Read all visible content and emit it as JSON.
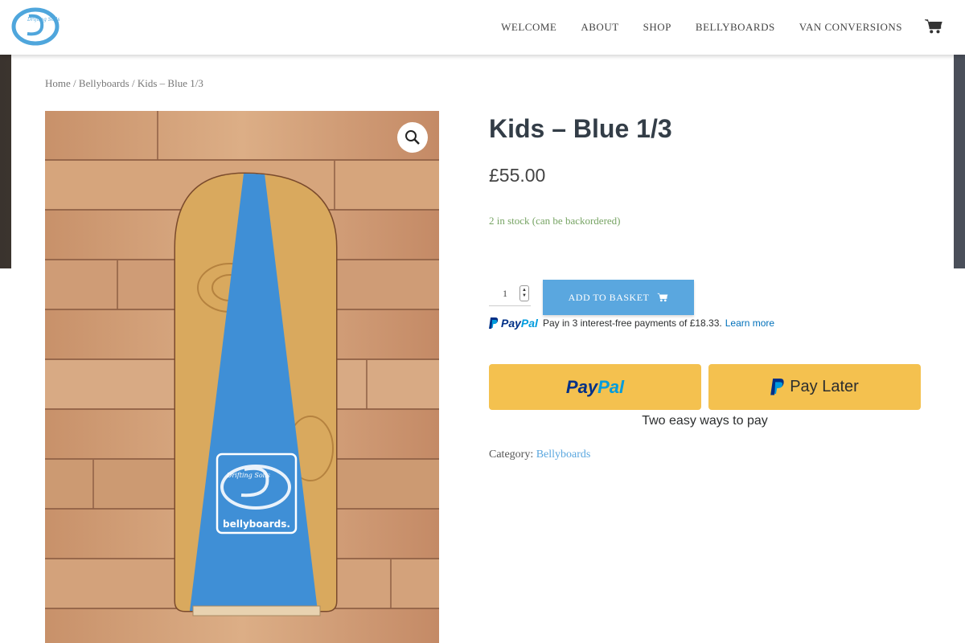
{
  "nav": {
    "items": [
      "WELCOME",
      "ABOUT",
      "SHOP",
      "BELLYBOARDS",
      "VAN CONVERSIONS"
    ],
    "cart_icon": "shopping-cart-icon"
  },
  "breadcrumb": {
    "home": "Home",
    "sep": " / ",
    "category": "Bellyboards",
    "current": "Kids – Blue 1/3"
  },
  "product": {
    "title": "Kids – Blue 1/3",
    "price": "£55.00",
    "stock": "2 in stock (can be backordered)",
    "quantity": "1",
    "add_to_basket": "ADD TO BASKET",
    "category_label": "Category:",
    "category_value": "Bellyboards",
    "image_logo_line1": "Drifting Soils",
    "image_logo_line2": "bellyboards."
  },
  "paypal": {
    "logo_pay": "Pay",
    "logo_pal": "Pal",
    "message": "Pay in 3 interest-free payments of £18.33.",
    "learn_more": "Learn more",
    "button_paypal_pay": "Pay",
    "button_paypal_pal": "Pal",
    "button_later": "Pay Later",
    "tagline": "Two easy ways to pay"
  },
  "colors": {
    "accent": "#5aa7df",
    "paypal_yellow": "#f4c14f",
    "stock_green": "#77a464",
    "board_blue": "#3f8fd6"
  }
}
